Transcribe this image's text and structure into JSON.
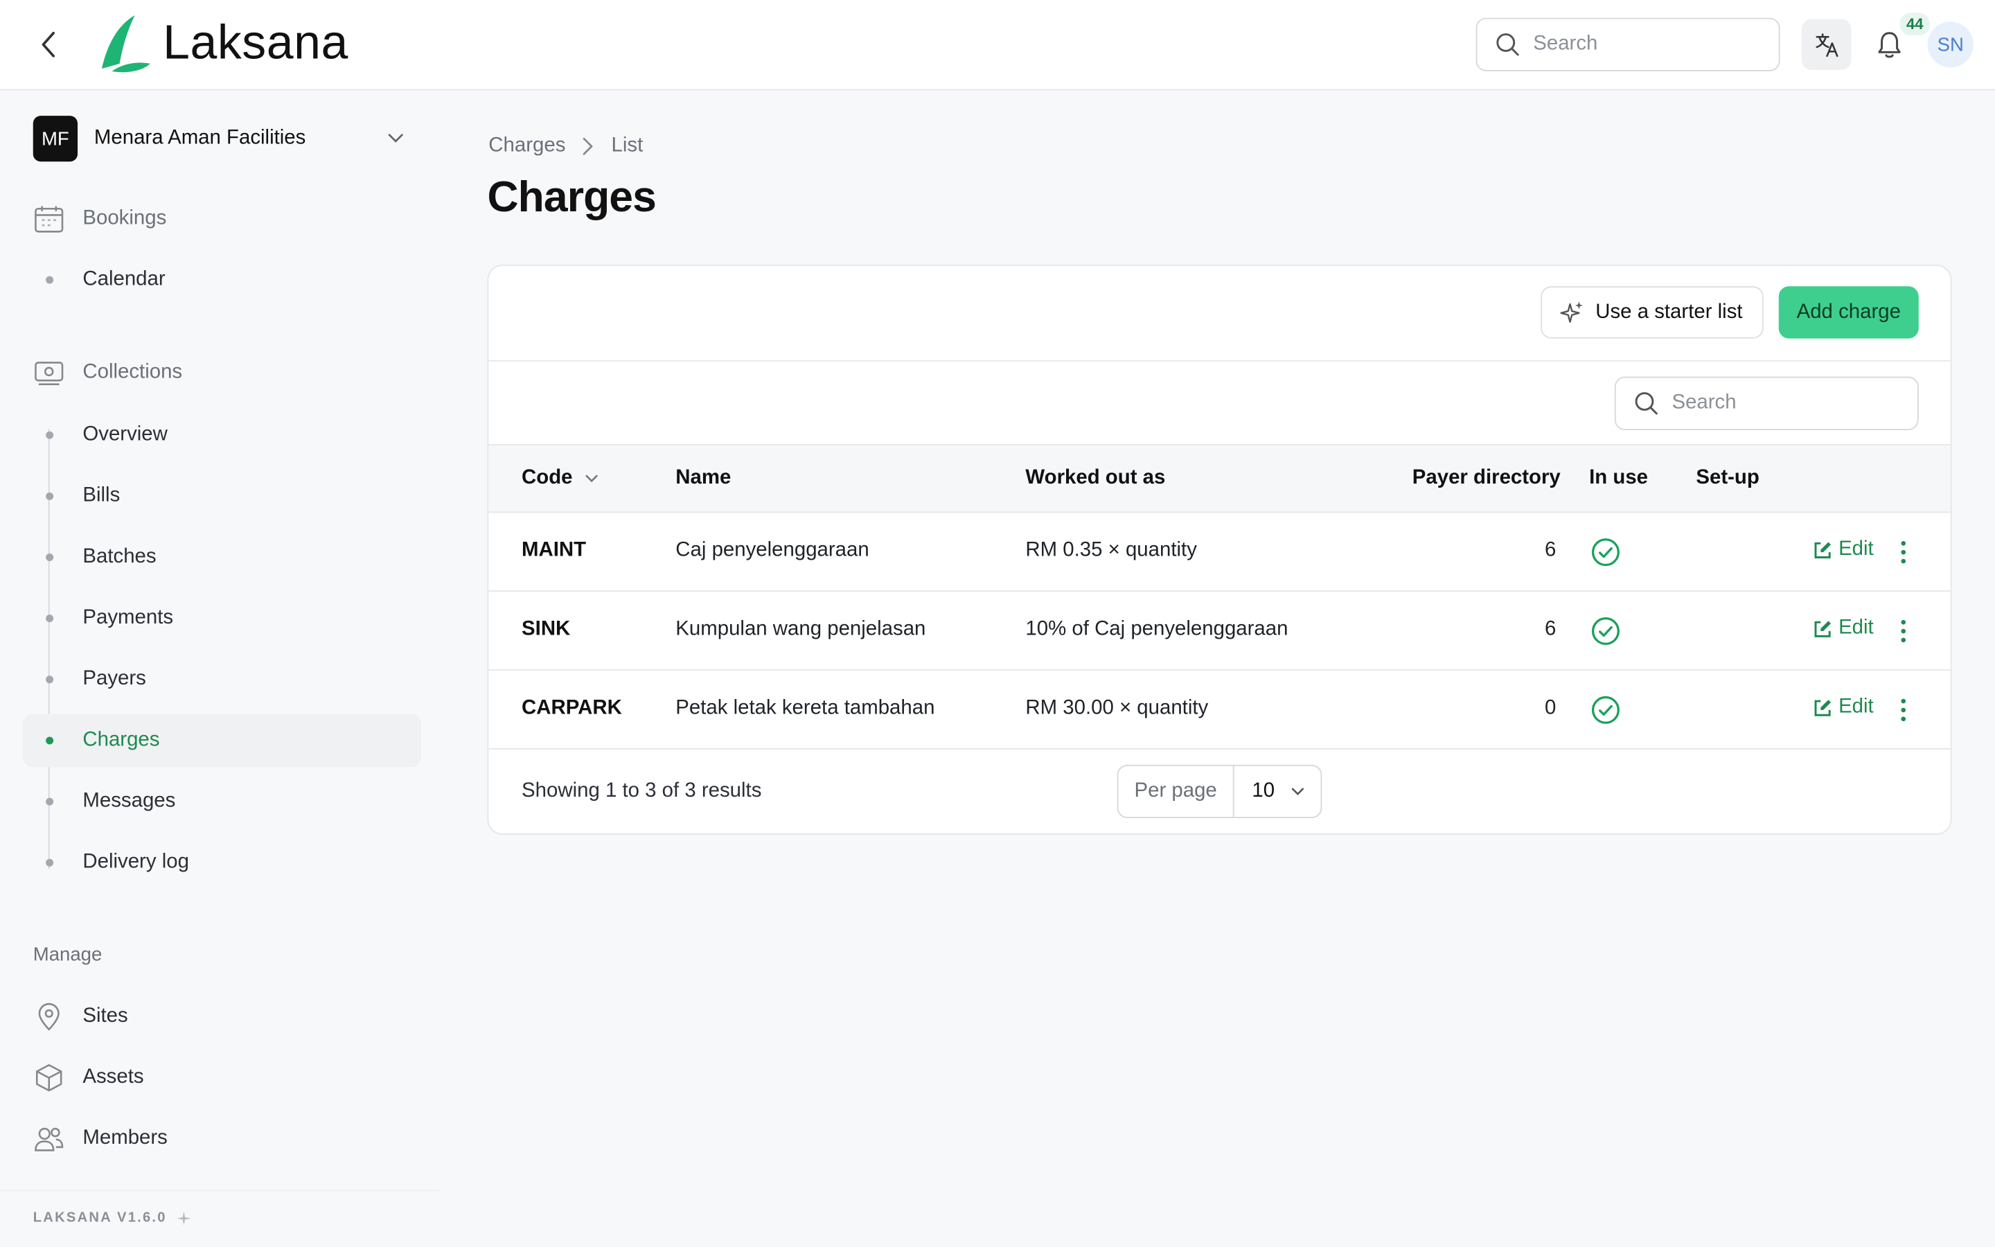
{
  "header": {
    "brand": "Laksana",
    "search_placeholder": "Search",
    "notification_count": "44",
    "user_initials": "SN"
  },
  "sidebar": {
    "org": {
      "initials": "MF",
      "name": "Menara Aman Facilities"
    },
    "bookings": {
      "label": "Bookings",
      "items": [
        {
          "label": "Calendar"
        }
      ]
    },
    "collections": {
      "label": "Collections",
      "items": [
        {
          "label": "Overview"
        },
        {
          "label": "Bills"
        },
        {
          "label": "Batches"
        },
        {
          "label": "Payments"
        },
        {
          "label": "Payers"
        },
        {
          "label": "Charges"
        },
        {
          "label": "Messages"
        },
        {
          "label": "Delivery log"
        }
      ]
    },
    "manage": {
      "label": "Manage",
      "items": [
        {
          "label": "Sites"
        },
        {
          "label": "Assets"
        },
        {
          "label": "Members"
        }
      ]
    },
    "version": "LAKSANA V1.6.0"
  },
  "breadcrumb": {
    "parent": "Charges",
    "current": "List"
  },
  "page_title": "Charges",
  "actions": {
    "starter_list": "Use a starter list",
    "add_charge": "Add charge"
  },
  "table_search_placeholder": "Search",
  "table": {
    "columns": {
      "code": "Code",
      "name": "Name",
      "worked_out_as": "Worked out as",
      "payer_directory": "Payer directory",
      "in_use": "In use",
      "setup": "Set-up"
    },
    "rows": [
      {
        "code": "MAINT",
        "name": "Caj penyelenggaraan",
        "worked_out_as": "RM 0.35 × quantity",
        "payer_directory": "6",
        "in_use": true,
        "edit": "Edit"
      },
      {
        "code": "SINK",
        "name": "Kumpulan wang penjelasan",
        "worked_out_as": "10% of Caj penyelenggaraan",
        "payer_directory": "6",
        "in_use": true,
        "edit": "Edit"
      },
      {
        "code": "CARPARK",
        "name": "Petak letak kereta tambahan",
        "worked_out_as": "RM 30.00 × quantity",
        "payer_directory": "0",
        "in_use": true,
        "edit": "Edit"
      }
    ]
  },
  "footer": {
    "results": "Showing 1 to 3 of 3 results",
    "per_page_label": "Per page",
    "per_page_value": "10"
  },
  "colors": {
    "brand_green": "#3ecf8e",
    "accent_green": "#1e8a4f",
    "check_green": "#1aa15a"
  }
}
